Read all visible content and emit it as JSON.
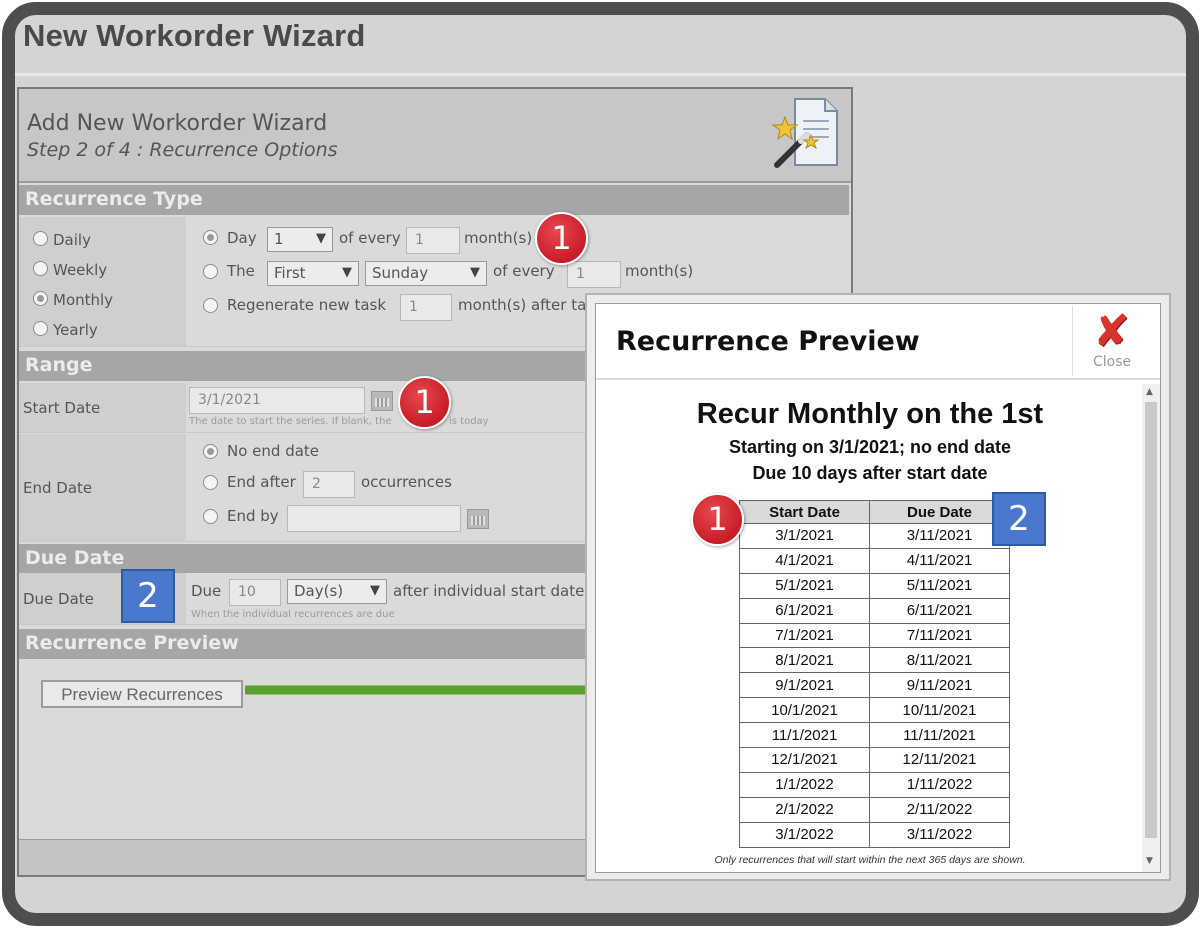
{
  "window": {
    "title": "New Workorder Wizard"
  },
  "wizard": {
    "title": "Add New Workorder Wizard",
    "step": "Step 2 of 4 : Recurrence Options",
    "sections": {
      "recurrence_type": "Recurrence Type",
      "range": "Range",
      "due_date": "Due Date",
      "recurrence_preview": "Recurrence Preview"
    },
    "recurrence_types": [
      "Daily",
      "Weekly",
      "Monthly",
      "Yearly"
    ],
    "selected_type": "Monthly",
    "monthly": {
      "day_label": "Day",
      "day_value": "1",
      "of_every": "of every",
      "every_value": "1",
      "months": "month(s)",
      "the_label": "The",
      "ordinal": "First",
      "weekday": "Sunday",
      "of_every_2": "of every",
      "every_value_2": "1",
      "months_2": "month(s)",
      "regen_label": "Regenerate new task",
      "regen_value": "1",
      "regen_suffix": "month(s) after ta"
    },
    "range": {
      "start_label": "Start Date",
      "start_value": "3/1/2021",
      "start_hint": "The date to start the series. If blank, the",
      "start_hint_end": "is today",
      "end_label": "End Date",
      "no_end": "No end date",
      "end_after": "End after",
      "end_after_value": "2",
      "occurrences": "occurrences",
      "end_by": "End by",
      "end_by_value": ""
    },
    "due": {
      "label": "Due Date",
      "due_word": "Due",
      "due_value": "10",
      "unit": "Day(s)",
      "after_text": "after individual start date",
      "hint": "When the individual recurrences are due"
    },
    "preview_button": "Preview Recurrences"
  },
  "callouts": {
    "red": "1",
    "blue": "2"
  },
  "preview": {
    "title": "Recurrence Preview",
    "close_label": "Close",
    "heading": "Recur Monthly on the 1st",
    "sub1": "Starting on 3/1/2021; no end date",
    "sub2": "Due 10 days after start date",
    "columns": [
      "Start Date",
      "Due Date"
    ],
    "rows": [
      [
        "3/1/2021",
        "3/11/2021"
      ],
      [
        "4/1/2021",
        "4/11/2021"
      ],
      [
        "5/1/2021",
        "5/11/2021"
      ],
      [
        "6/1/2021",
        "6/11/2021"
      ],
      [
        "7/1/2021",
        "7/11/2021"
      ],
      [
        "8/1/2021",
        "8/11/2021"
      ],
      [
        "9/1/2021",
        "9/11/2021"
      ],
      [
        "10/1/2021",
        "10/11/2021"
      ],
      [
        "11/1/2021",
        "11/11/2021"
      ],
      [
        "12/1/2021",
        "12/11/2021"
      ],
      [
        "1/1/2022",
        "1/11/2022"
      ],
      [
        "2/1/2022",
        "2/11/2022"
      ],
      [
        "3/1/2022",
        "3/11/2022"
      ]
    ],
    "note": "Only recurrences that will start within the next 365 days are shown."
  },
  "colors": {
    "badge_red": "#c71d26",
    "badge_blue": "#4a78cc",
    "arrow_green": "#5aa02c"
  }
}
